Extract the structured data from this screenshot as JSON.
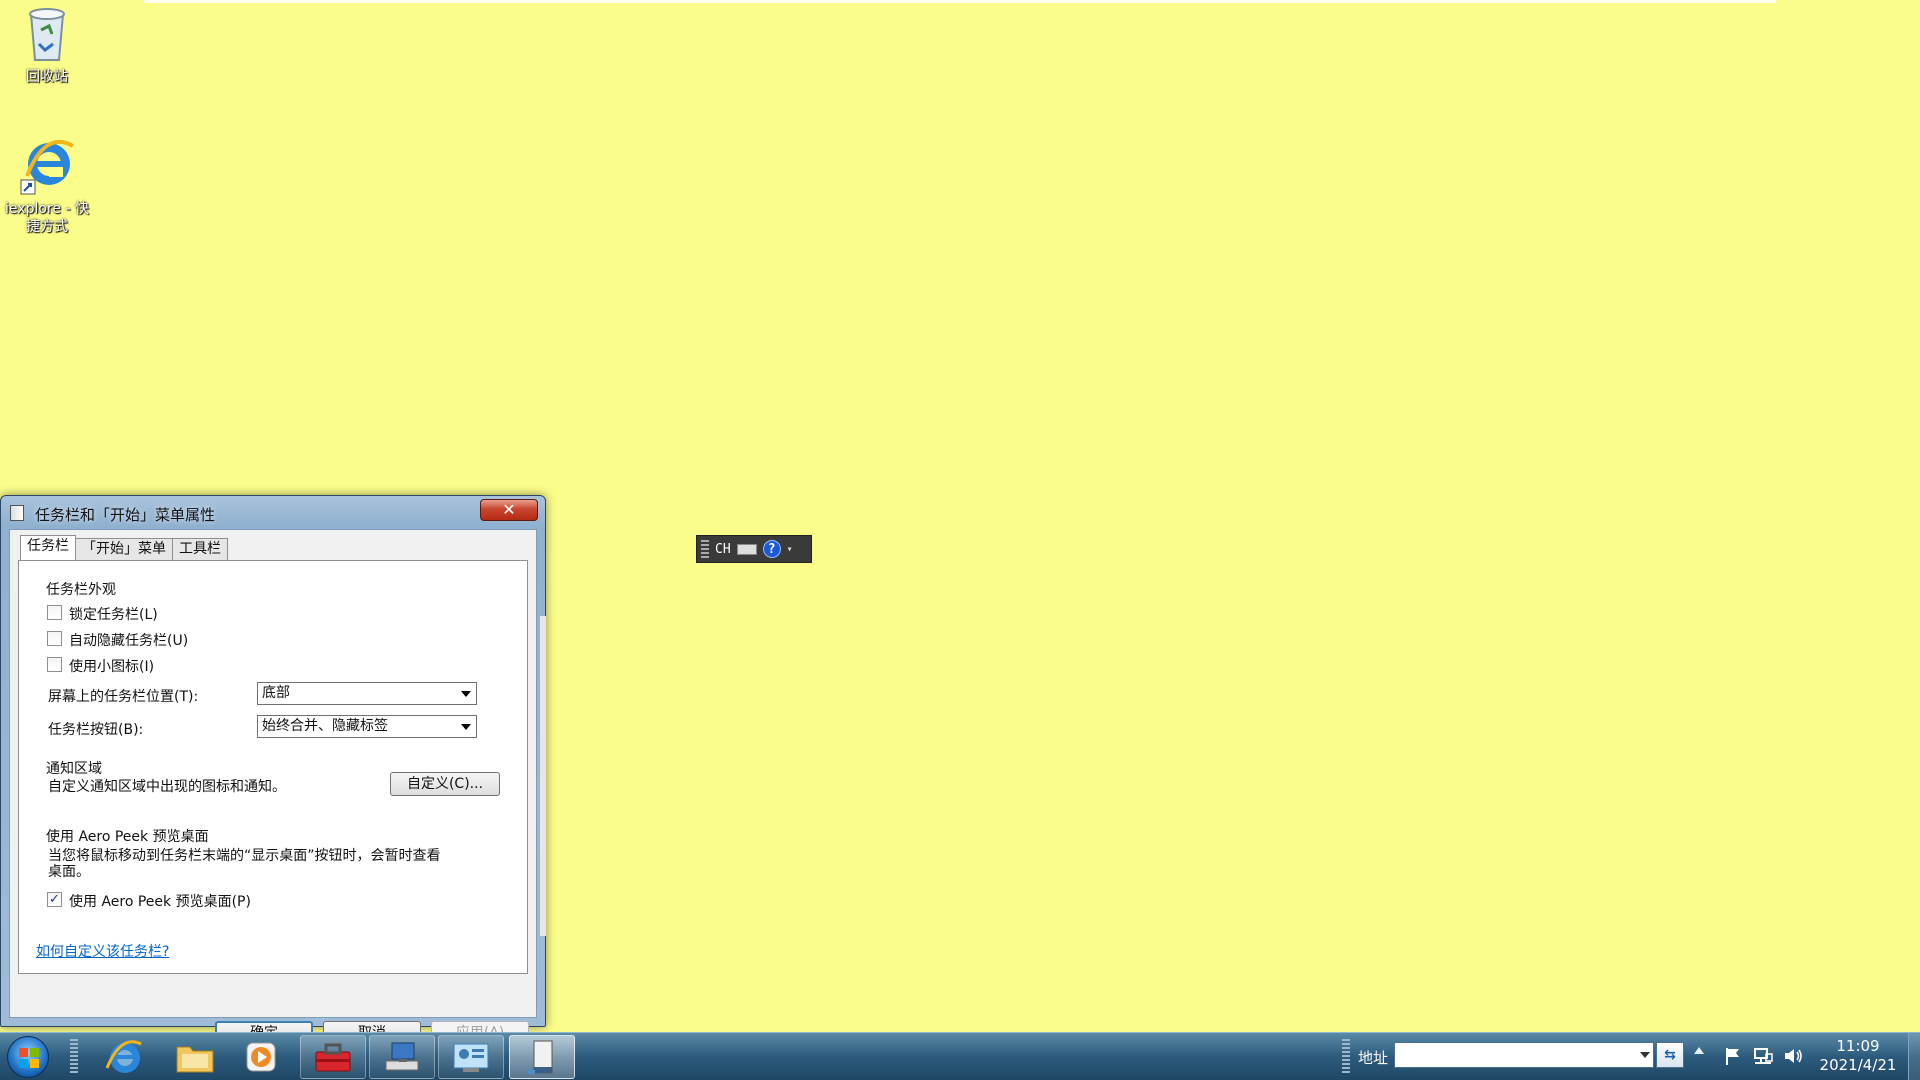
{
  "desktop": {
    "icons": [
      {
        "label": "回收站",
        "icon": "recycle-bin-icon"
      },
      {
        "label": "iexplore - 快捷方式",
        "icon": "internet-explorer-icon"
      }
    ]
  },
  "langbar": {
    "lang": "CH",
    "help": "?",
    "menu": "▾"
  },
  "dialog": {
    "title": "任务栏和「开始」菜单属性",
    "close_label": "✕",
    "tabs": [
      {
        "label": "任务栏",
        "active": true
      },
      {
        "label": "「开始」菜单",
        "active": false
      },
      {
        "label": "工具栏",
        "active": false
      }
    ],
    "appearance": {
      "heading": "任务栏外观",
      "lock": {
        "label": "锁定任务栏(L)",
        "checked": false
      },
      "autohide": {
        "label": "自动隐藏任务栏(U)",
        "checked": false
      },
      "small_icons": {
        "label": "使用小图标(I)",
        "checked": false
      },
      "position": {
        "label": "屏幕上的任务栏位置(T):",
        "value": "底部"
      },
      "buttons": {
        "label": "任务栏按钮(B):",
        "value": "始终合并、隐藏标签"
      }
    },
    "notify": {
      "heading": "通知区域",
      "desc": "自定义通知区域中出现的图标和通知。",
      "customize_label": "自定义(C)..."
    },
    "peek": {
      "heading": "使用 Aero Peek 预览桌面",
      "desc_line1": "当您将鼠标移动到任务栏末端的“显示桌面”按钮时，会暂时查看",
      "desc_line2": "桌面。",
      "use": {
        "label": "使用 Aero Peek 预览桌面(P)",
        "checked": true,
        "mark": "✓"
      }
    },
    "help_link": "如何自定义该任务栏?",
    "ok_label": "确定",
    "cancel_label": "取消",
    "apply_label": "应用(A)"
  },
  "taskbar": {
    "items": [
      {
        "icon": "internet-explorer-icon",
        "state": "pinned"
      },
      {
        "icon": "folder-icon",
        "state": "pinned"
      },
      {
        "icon": "media-player-icon",
        "state": "pinned"
      },
      {
        "icon": "toolbox-icon",
        "state": "running"
      },
      {
        "icon": "computer-network-icon",
        "state": "running"
      },
      {
        "icon": "control-panel-icon",
        "state": "running"
      },
      {
        "icon": "taskbar-properties-icon",
        "state": "active"
      }
    ],
    "address_label": "地址",
    "address_value": "",
    "go_label": "⇆",
    "clock_time": "11:09",
    "clock_date": "2021/4/21"
  },
  "colors": {
    "desktop_bg": "#fbfd8a",
    "link": "#0066cc",
    "close_red": "#c9472f"
  }
}
